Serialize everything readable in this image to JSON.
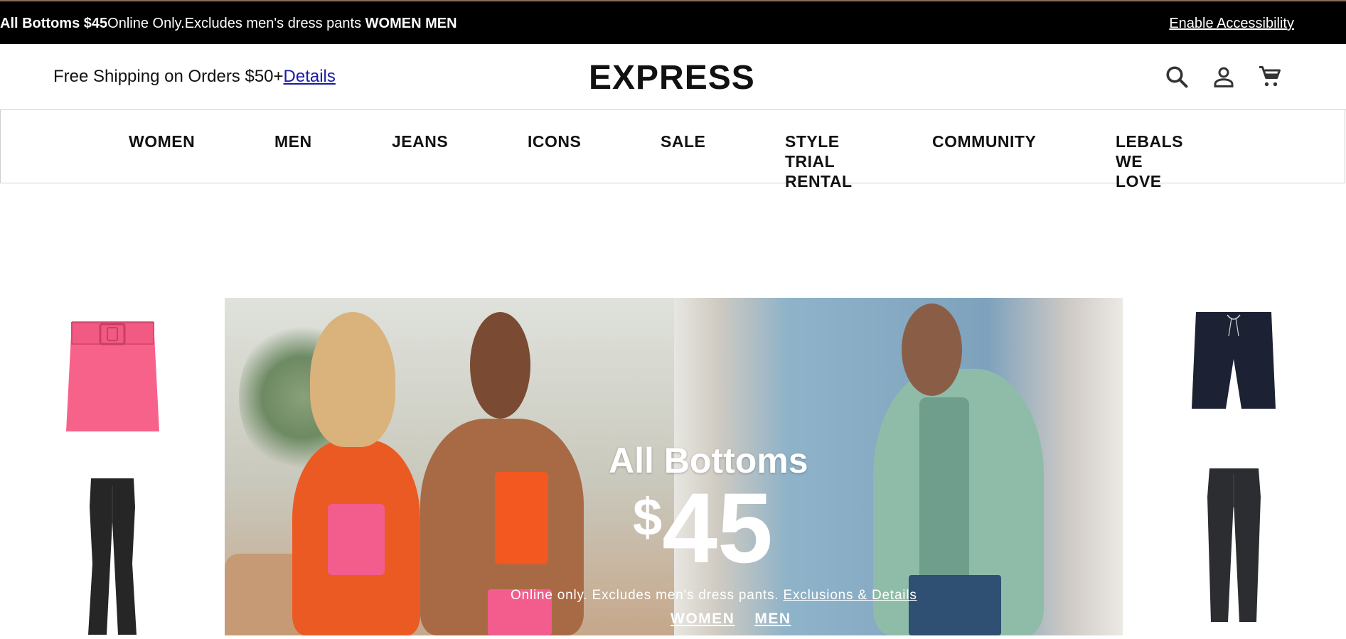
{
  "promo_bar": {
    "bold_text": "All Bottoms $45",
    "text": "Online Only.Excludes men's dress pants ",
    "women_link": "WOMEN",
    "men_link": "MEN",
    "accessibility_link": "Enable Accessibility"
  },
  "header": {
    "shipping_text": "Free Shipping on Orders $50+",
    "details_link": "Details",
    "logo": "EXPRESS",
    "icons": [
      "search-icon",
      "account-icon",
      "cart-icon"
    ]
  },
  "nav": {
    "items": [
      {
        "label": "WOMEN"
      },
      {
        "label": "MEN"
      },
      {
        "label": "JEANS"
      },
      {
        "label": "ICONS"
      },
      {
        "label": "SALE"
      },
      {
        "line1": "STYLE",
        "line2": "TRIAL",
        "line3": "RENTAL"
      },
      {
        "label": "COMMUNITY"
      },
      {
        "line1": "LEBALS",
        "line2": "WE",
        "line3": "LOVE"
      }
    ]
  },
  "hero": {
    "title": "All Bottoms",
    "currency": "$",
    "price": "45",
    "subtext": "Online only. Excludes men's dress pants. ",
    "exclusions_link": "Exclusions & Details",
    "women_link": "WOMEN",
    "men_link": "MEN"
  },
  "colors": {
    "promo_bg": "#000000",
    "pink_skirt": "#f7628a",
    "navy_shorts": "#1c2233",
    "black_jeans": "#262626",
    "link_blue": "#1a1aa6"
  }
}
